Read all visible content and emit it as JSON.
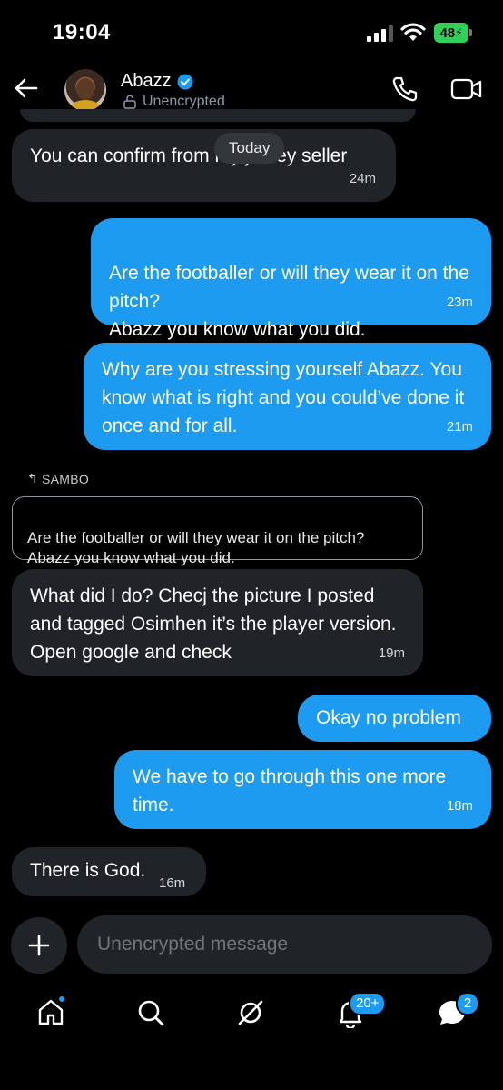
{
  "status_bar": {
    "time": "19:04",
    "battery": "48"
  },
  "header": {
    "contact_name": "Abazz",
    "encryption_status": "Unencrypted"
  },
  "chat": {
    "date_pill": "Today",
    "messages": [
      {
        "direction": "received",
        "text": "You can confirm from my jersey seller",
        "time": "24m"
      },
      {
        "direction": "sent",
        "text": "Are the footballer or will they wear it on the pitch?\nAbazz you know what you did.",
        "time": "23m"
      },
      {
        "direction": "sent",
        "text": "Why are you stressing yourself Abazz. You know what is right and you could’ve done it once and for all.",
        "time": "21m"
      },
      {
        "direction": "received",
        "reply_to_label": "SAMBO",
        "quoted_text": "Are the footballer or will they wear it on the pitch?\nAbazz you know what you did.",
        "text": "What did I do? Checj the picture I posted and tagged Osimhen it’s the player version. Open google and check",
        "time": "19m"
      },
      {
        "direction": "sent",
        "text": "Okay no problem",
        "time": ""
      },
      {
        "direction": "sent",
        "text": "We have to go through this one more time.",
        "time": "18m"
      },
      {
        "direction": "received",
        "text": "There is God.",
        "time": "16m"
      }
    ]
  },
  "composer": {
    "placeholder": "Unencrypted message"
  },
  "bottom_nav": {
    "items": [
      {
        "icon": "home-icon",
        "has_dot": true
      },
      {
        "icon": "search-icon"
      },
      {
        "icon": "grok-icon"
      },
      {
        "icon": "notifications-icon",
        "badge": "20+"
      },
      {
        "icon": "messages-icon",
        "badge": "2"
      }
    ]
  },
  "colors": {
    "sent_bubble": "#1d9bf0",
    "received_bubble": "#202327",
    "background": "#000000",
    "battery": "#30d158"
  }
}
